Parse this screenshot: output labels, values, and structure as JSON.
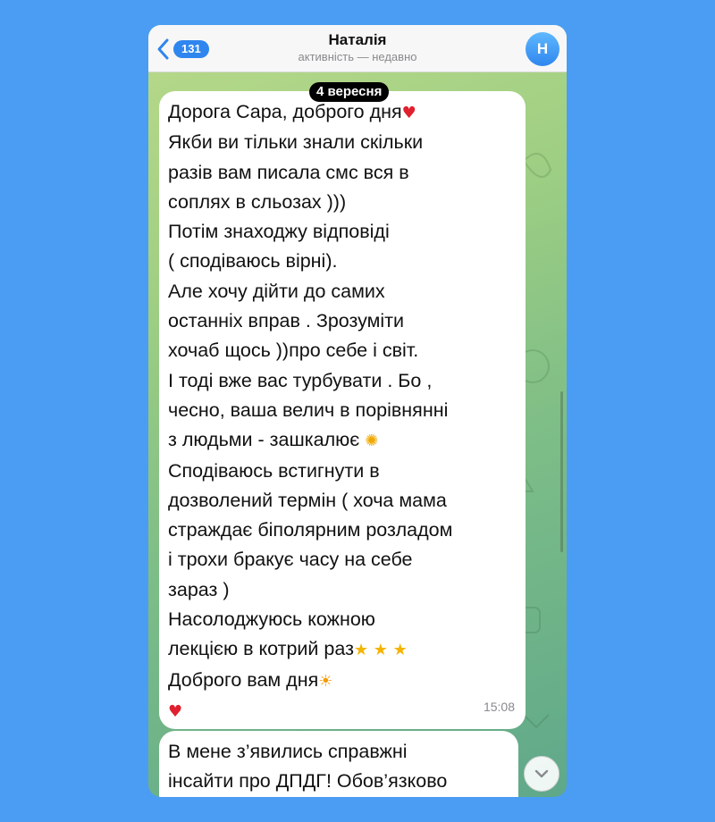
{
  "header": {
    "back_count": "131",
    "chat_title": "Наталія",
    "chat_status": "активність — недавно",
    "avatar_letter": "Н"
  },
  "date_separator": "4 вересня",
  "messages": [
    {
      "lines": [
        "Дорога Сара, доброго дня",
        "Якби ви тільки знали скільки",
        "разів вам писала смс вся в",
        "соплях в сльозах )))",
        "Потім знаходжу відповіді",
        "( сподіваюсь вірні).",
        "Але хочу дійти до самих",
        "останніх вправ . Зрозуміти",
        "хочаб щось ))про себе і світ.",
        "І тоді вже вас турбувати . Бо ,",
        "чесно, ваша велич в порівнянні",
        "з людьми - зашкалює",
        "Сподіваюсь встигнути в",
        "дозволений термін ( хоча мама",
        "страждає біполярним розладом",
        "і трохи бракує часу на себе",
        "зараз )",
        "Насолоджуюсь кожною",
        "лекцією в котрий раз",
        "Доброго вам дня",
        ""
      ],
      "time": "15:08"
    },
    {
      "lines": [
        "В мене з’явились справжні",
        "інсайти про ДПДГ! Обов’язково"
      ]
    }
  ],
  "icons": {
    "back": "chevron-left-icon",
    "scroll_down": "chevron-down-icon",
    "heart": "red-heart-emoji",
    "dizzy": "dizzy-emoji",
    "star": "glowing-star-emoji",
    "sun": "sun-emoji"
  },
  "colors": {
    "page_background": "#4a9df3",
    "accent": "#2f86ee",
    "date_pill": "#000000",
    "bubble": "#ffffff",
    "chat_bg_top": "#b9d98a",
    "chat_bg_bottom": "#5fa88a"
  }
}
